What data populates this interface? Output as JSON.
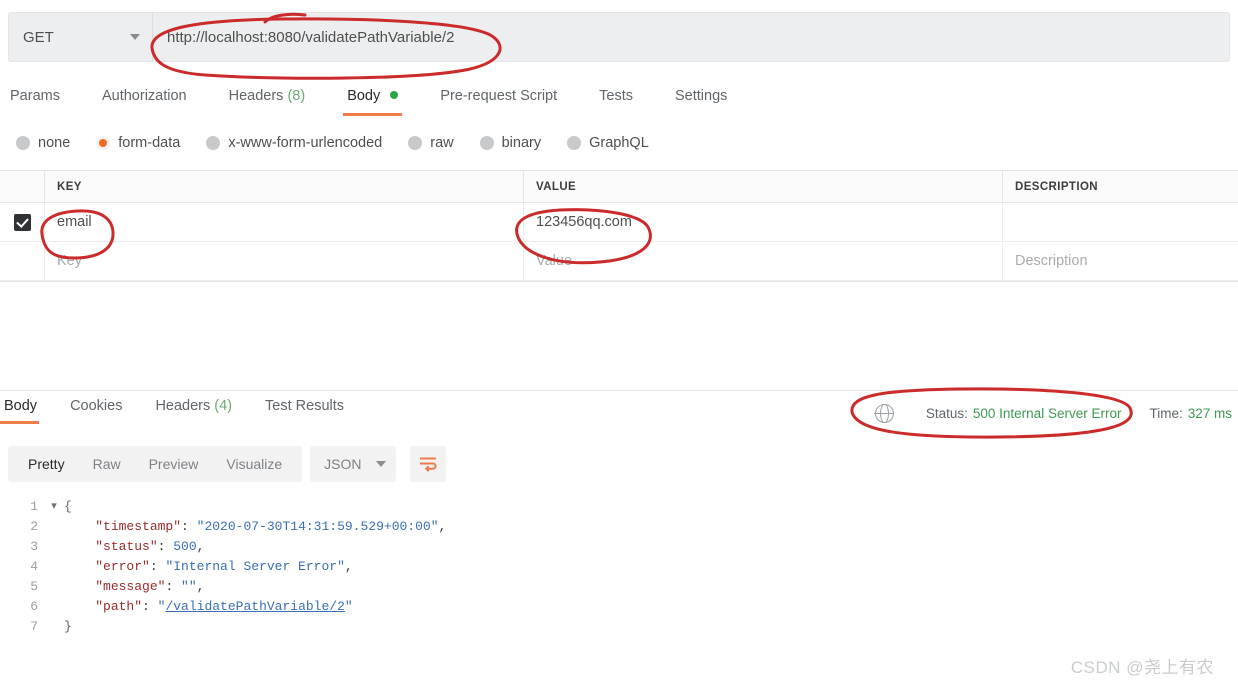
{
  "request": {
    "method": "GET",
    "url": "http://localhost:8080/validatePathVariable/2",
    "tabs": [
      {
        "label": "Params",
        "count": "",
        "active": false
      },
      {
        "label": "Authorization",
        "count": "",
        "active": false
      },
      {
        "label": "Headers",
        "count": "(8)",
        "active": false
      },
      {
        "label": "Body",
        "count": "",
        "active": true,
        "dot": true
      },
      {
        "label": "Pre-request Script",
        "count": "",
        "active": false
      },
      {
        "label": "Tests",
        "count": "",
        "active": false
      },
      {
        "label": "Settings",
        "count": "",
        "active": false
      }
    ],
    "body_types": [
      {
        "label": "none",
        "selected": false
      },
      {
        "label": "form-data",
        "selected": true
      },
      {
        "label": "x-www-form-urlencoded",
        "selected": false
      },
      {
        "label": "raw",
        "selected": false
      },
      {
        "label": "binary",
        "selected": false
      },
      {
        "label": "GraphQL",
        "selected": false
      }
    ],
    "table": {
      "headers": {
        "key": "KEY",
        "value": "VALUE",
        "description": "DESCRIPTION"
      },
      "rows": [
        {
          "checked": true,
          "key": "email",
          "value": "123456qq.com",
          "description": ""
        }
      ],
      "placeholders": {
        "key": "Key",
        "value": "Value",
        "description": "Description"
      }
    }
  },
  "response": {
    "tabs": [
      {
        "label": "Body",
        "count": "",
        "active": true
      },
      {
        "label": "Cookies",
        "count": "",
        "active": false
      },
      {
        "label": "Headers",
        "count": "(4)",
        "active": false
      },
      {
        "label": "Test Results",
        "count": "",
        "active": false
      }
    ],
    "status_label": "Status:",
    "status_value": "500 Internal Server Error",
    "time_label": "Time:",
    "time_value": "327 ms",
    "view_modes": [
      {
        "label": "Pretty",
        "active": true
      },
      {
        "label": "Raw",
        "active": false
      },
      {
        "label": "Preview",
        "active": false
      },
      {
        "label": "Visualize",
        "active": false
      }
    ],
    "format": "JSON",
    "code_lines": [
      {
        "n": "1",
        "fold": true
      },
      {
        "n": "2",
        "fold": false
      },
      {
        "n": "3",
        "fold": false
      },
      {
        "n": "4",
        "fold": false
      },
      {
        "n": "5",
        "fold": false
      },
      {
        "n": "6",
        "fold": false
      },
      {
        "n": "7",
        "fold": false
      }
    ],
    "json": {
      "open_brace": "{",
      "close_brace": "}",
      "timestamp_key": "\"timestamp\"",
      "timestamp_val": "\"2020-07-30T14:31:59.529+00:00\"",
      "status_key": "\"status\"",
      "status_val": "500",
      "error_key": "\"error\"",
      "error_val": "\"Internal Server Error\"",
      "message_key": "\"message\"",
      "message_val": "\"\"",
      "path_key": "\"path\"",
      "path_val_open": "\"",
      "path_val_link": "/validatePathVariable/2",
      "path_val_close": "\"",
      "colon": ": ",
      "comma": ","
    }
  },
  "watermark": "CSDN @尧上有农",
  "colors": {
    "accent_orange": "#ef7c48",
    "status_green": "#3f9a53",
    "annotation_red": "#cc2b2b",
    "body_dot_green": "#29a745"
  }
}
